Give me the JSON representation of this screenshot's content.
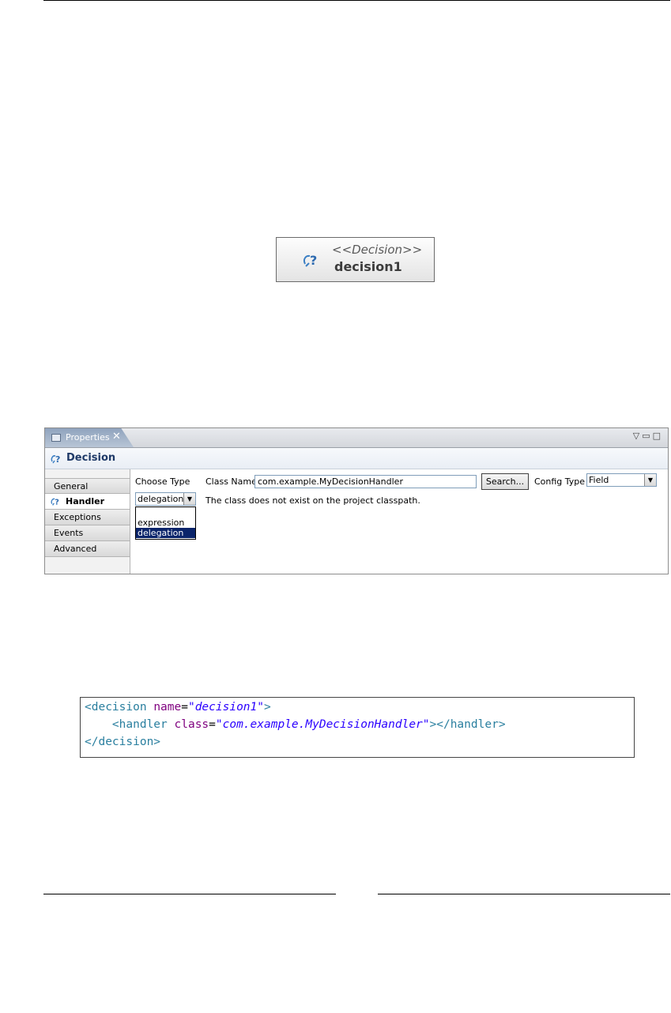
{
  "diagram_node": {
    "stereotype": "<<Decision>>",
    "name": "decision1",
    "icon": "decision-icon"
  },
  "properties_view": {
    "tab_label": "Properties",
    "section_title": "Decision",
    "sidebar": {
      "items": [
        {
          "label": "General",
          "selected": false
        },
        {
          "label": "Handler",
          "selected": true
        },
        {
          "label": "Exceptions",
          "selected": false
        },
        {
          "label": "Events",
          "selected": false
        },
        {
          "label": "Advanced",
          "selected": false
        }
      ]
    },
    "choose_type": {
      "label": "Choose Type",
      "value": "delegation",
      "options": [
        "expression",
        "delegation"
      ]
    },
    "class_name": {
      "label": "Class Name",
      "value": "com.example.MyDecisionHandler",
      "error": "The class does not exist on the project classpath."
    },
    "search_button": "Search...",
    "config_type": {
      "label": "Config Type",
      "value": "Field"
    }
  },
  "code": {
    "line1": {
      "open": "<decision ",
      "attr": "name",
      "eq": "=",
      "str": "\"decision1\"",
      "close": ">"
    },
    "line2": {
      "indent": "    ",
      "open": "<handler ",
      "attr": "class",
      "eq": "=",
      "str": "\"com.example.MyDecisionHandler\"",
      "close": "></handler>"
    },
    "line3": {
      "text": "</decision>"
    }
  },
  "colors": {
    "tab_active": "#8fa3bd",
    "selection": "#0a246a",
    "xml_tag": "#2a7f9f",
    "xml_attr": "#7f007f",
    "xml_string": "#2a00ff"
  }
}
